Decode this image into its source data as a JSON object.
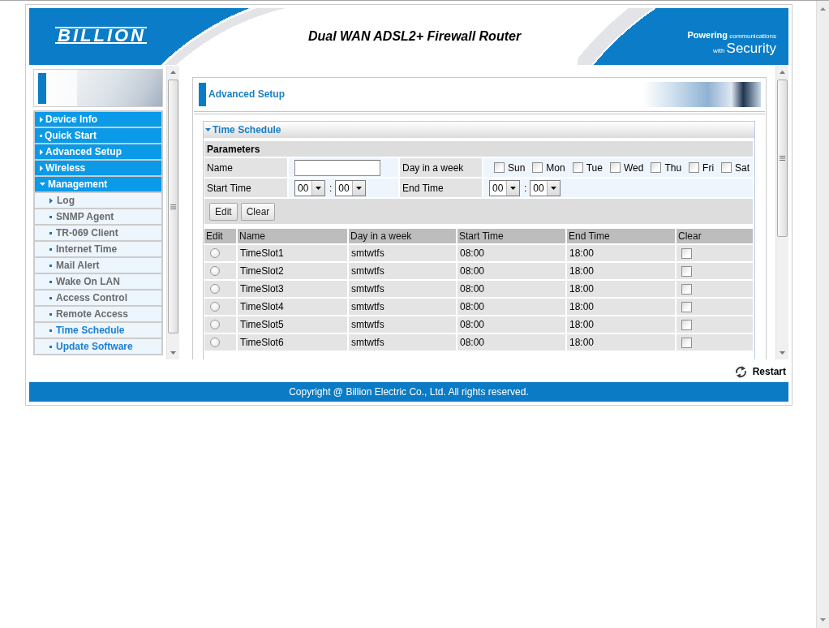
{
  "header": {
    "logo": "BILLION",
    "title": "Dual WAN ADSL2+ Firewall Router",
    "slogan": [
      [
        "Powering",
        "communications"
      ],
      [
        "with",
        "Security"
      ]
    ]
  },
  "sidebar": {
    "items": [
      {
        "label": "Device Info",
        "kind": "folder",
        "expanded": false
      },
      {
        "label": "Quick Start",
        "kind": "page",
        "expanded": false
      },
      {
        "label": "Advanced Setup",
        "kind": "folder",
        "expanded": false
      },
      {
        "label": "Wireless",
        "kind": "folder",
        "expanded": false
      },
      {
        "label": "Management",
        "kind": "folder",
        "expanded": true,
        "children": [
          {
            "label": "Log",
            "kind": "folder",
            "expanded": false,
            "highlighted": false
          },
          {
            "label": "SNMP Agent",
            "kind": "page",
            "expanded": false,
            "highlighted": false
          },
          {
            "label": "TR-069 Client",
            "kind": "page",
            "expanded": false,
            "highlighted": false
          },
          {
            "label": "Internet Time",
            "kind": "page",
            "expanded": false,
            "highlighted": false
          },
          {
            "label": "Mail Alert",
            "kind": "page",
            "expanded": false,
            "highlighted": false
          },
          {
            "label": "Wake On LAN",
            "kind": "page",
            "expanded": false,
            "highlighted": false
          },
          {
            "label": "Access Control",
            "kind": "page",
            "expanded": false,
            "highlighted": false
          },
          {
            "label": "Remote Access",
            "kind": "page",
            "expanded": false,
            "highlighted": false
          },
          {
            "label": "Time Schedule",
            "kind": "page",
            "expanded": false,
            "highlighted": true
          },
          {
            "label": "Update Software",
            "kind": "page",
            "expanded": false,
            "highlighted": true
          }
        ]
      }
    ]
  },
  "content": {
    "title": "Advanced Setup",
    "section": {
      "title": "Time Schedule",
      "expanded": true,
      "form": {
        "heading": "Parameters",
        "name_label": "Name",
        "days_label": "Day in a week",
        "days": [
          {
            "label": "Sun",
            "checked": false
          },
          {
            "label": "Mon",
            "checked": false
          },
          {
            "label": "Tue",
            "checked": false
          },
          {
            "label": "Wed",
            "checked": false
          },
          {
            "label": "Thu",
            "checked": false
          },
          {
            "label": "Fri",
            "checked": false
          },
          {
            "label": "Sat",
            "checked": false
          }
        ],
        "start_label": "Start Time",
        "start": {
          "hour": "00",
          "separator": ":",
          "minute": "00"
        },
        "end_label": "End Time",
        "end": {
          "hour": "00",
          "separator": ":",
          "minute": "00"
        }
      },
      "buttons": [
        {
          "label": "Edit"
        },
        {
          "label": "Clear"
        }
      ],
      "table": {
        "columns": [
          "Edit",
          "Name",
          "Day in a week",
          "Start Time",
          "End Time",
          "Clear"
        ],
        "rows": [
          {
            "selected": false,
            "name": "TimeSlot1",
            "days": "smtwtfs",
            "start": "08:00",
            "end": "18:00",
            "clear_checked": false
          },
          {
            "selected": false,
            "name": "TimeSlot2",
            "days": "smtwtfs",
            "start": "08:00",
            "end": "18:00",
            "clear_checked": false
          },
          {
            "selected": false,
            "name": "TimeSlot3",
            "days": "smtwtfs",
            "start": "08:00",
            "end": "18:00",
            "clear_checked": false
          },
          {
            "selected": false,
            "name": "TimeSlot4",
            "days": "smtwtfs",
            "start": "08:00",
            "end": "18:00",
            "clear_checked": false
          },
          {
            "selected": false,
            "name": "TimeSlot5",
            "days": "smtwtfs",
            "start": "08:00",
            "end": "18:00",
            "clear_checked": false
          },
          {
            "selected": false,
            "name": "TimeSlot6",
            "days": "smtwtfs",
            "start": "08:00",
            "end": "18:00",
            "clear_checked": false
          }
        ]
      }
    }
  },
  "restart": "Restart",
  "footer": "Copyright @ Billion Electric Co., Ltd. All rights reserved."
}
